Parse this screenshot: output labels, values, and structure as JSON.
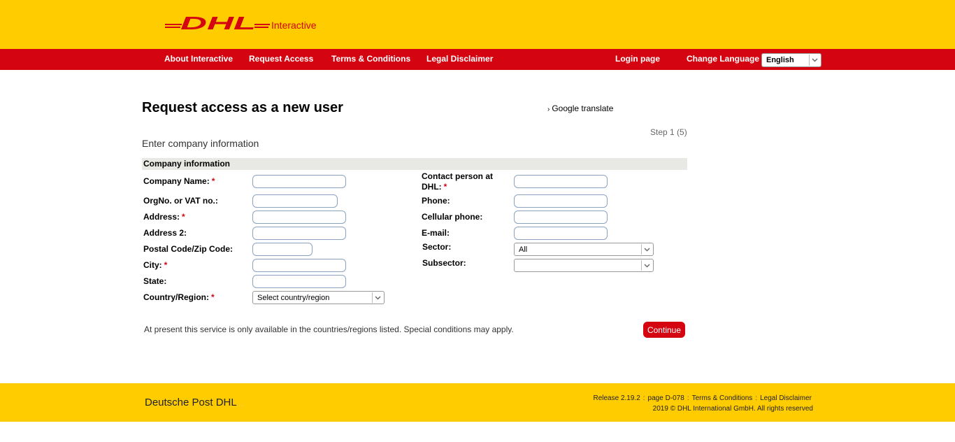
{
  "header": {
    "logo_text": "DHL",
    "logo_sub": "Interactive"
  },
  "nav": {
    "items": [
      {
        "label": "About Interactive"
      },
      {
        "label": "Request Access"
      },
      {
        "label": "Terms & Conditions"
      },
      {
        "label": "Legal Disclaimer"
      },
      {
        "label": "Login page"
      }
    ],
    "language_label": "Change Language",
    "language_value": "English"
  },
  "main": {
    "title": "Request access as a new user",
    "google_translate": "Google translate",
    "step": "Step 1 (5)",
    "subtitle": "Enter company information",
    "section_title": "Company information",
    "left_fields": [
      {
        "label": "Company Name:",
        "required": "*"
      },
      {
        "label": "OrgNo. or VAT no.:"
      },
      {
        "label": "Address:",
        "required": "*"
      },
      {
        "label": "Address 2:"
      },
      {
        "label": "Postal Code/Zip Code:"
      },
      {
        "label": "City:",
        "required": "*"
      },
      {
        "label": "State:"
      },
      {
        "label": "Country/Region:",
        "required": "*",
        "select_value": "Select country/region"
      }
    ],
    "right_fields": [
      {
        "label_line1": "Contact person at",
        "label_line2": "DHL:",
        "required": "*"
      },
      {
        "label": "Phone:"
      },
      {
        "label": "Cellular phone:"
      },
      {
        "label": "E-mail:"
      },
      {
        "label": "Sector:",
        "select_value": "All"
      },
      {
        "label": "Subsector:",
        "select_value": ""
      }
    ],
    "note": "At present this service is only available in the countries/regions listed. Special conditions may apply.",
    "continue_label": "Continue"
  },
  "footer": {
    "brand": "Deutsche Post DHL",
    "release": "Release 2.19.2",
    "page": "page D-078",
    "terms": "Terms & Conditions",
    "legal": "Legal Disclaimer",
    "copyright": "2019 © DHL International GmbH. All rights reserved",
    "separator": ":"
  },
  "colors": {
    "yellow": "#ffcc00",
    "red": "#d40511"
  }
}
